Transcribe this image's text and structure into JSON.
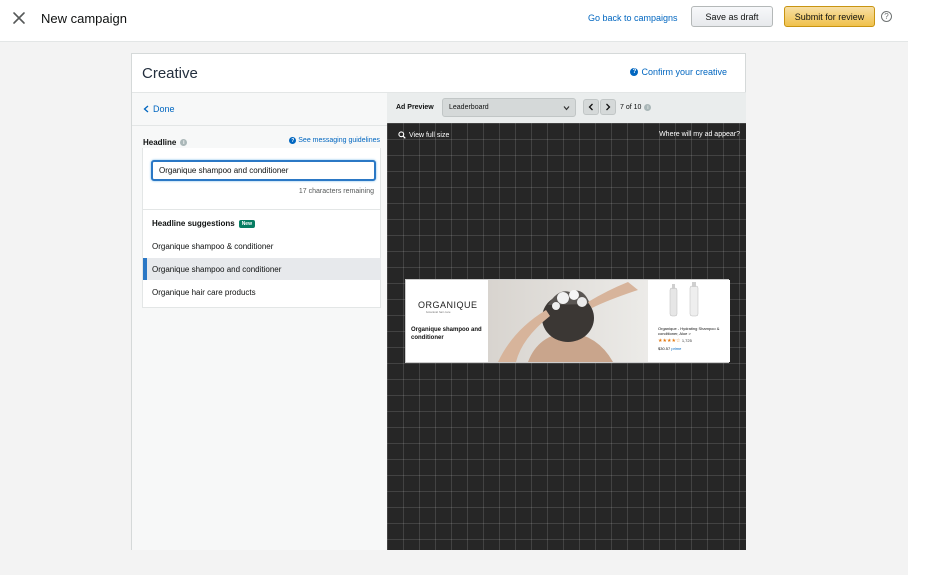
{
  "header": {
    "title": "New campaign",
    "back_link": "Go back to campaigns",
    "save_draft": "Save as draft",
    "submit": "Submit for review",
    "help": "?"
  },
  "card": {
    "title": "Creative",
    "confirm_link": "Confirm your creative"
  },
  "left_panel": {
    "done": "Done",
    "headline_label": "Headline",
    "guidelines_link": "See messaging guidelines",
    "headline_value": "Organique shampoo and conditioner",
    "chars_remaining": "17 characters remaining",
    "suggestions_title": "Headline suggestions",
    "new_badge": "New",
    "suggestions": [
      "Organique shampoo & conditioner",
      "Organique shampoo and conditioner",
      "Organique hair care products"
    ],
    "selected_suggestion_index": 1
  },
  "preview": {
    "label": "Ad Preview",
    "size": "Leaderboard",
    "pager": "7 of 10",
    "view_full": "View full size",
    "where_link": "Where will my ad appear?"
  },
  "ad": {
    "logo": "ORGANIQUE",
    "logo_sub": "botanical hair care",
    "headline": "Organique shampoo and conditioner",
    "product_name": "Organique - Hydrating Shampoo & conditioner, Aloe >",
    "rating_count": "1,725",
    "price": "$30.57",
    "prime": "prime",
    "stars": "★★★★☆"
  },
  "colors": {
    "link": "#0066c0",
    "submit_bg": "#f0c14b",
    "selected_accent": "#2b78c5",
    "preview_canvas": "#262626",
    "new_badge": "#067d62"
  }
}
